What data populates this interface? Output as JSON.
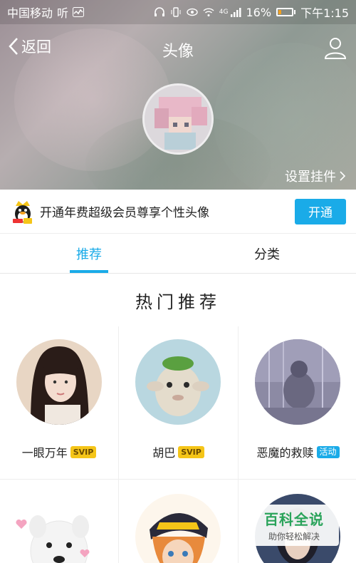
{
  "status_bar": {
    "carrier": "中国移动",
    "speaker_hint": "听",
    "signal_label": "4G",
    "battery": "16%",
    "time": "下午1:15"
  },
  "nav": {
    "back_label": "返回",
    "title": "头像"
  },
  "hero": {
    "pendant_label": "设置挂件"
  },
  "vip_banner": {
    "text": "开通年费超级会员尊享个性头像",
    "button_label": "开通"
  },
  "tabs": [
    {
      "label": "推荐",
      "active": true
    },
    {
      "label": "分类",
      "active": false
    }
  ],
  "section_title": "热门推荐",
  "grid": {
    "items": [
      {
        "name": "一眼万年",
        "badge": "SVIP",
        "badge_type": "svip"
      },
      {
        "name": "胡巴",
        "badge": "SVIP",
        "badge_type": "svip"
      },
      {
        "name": "恶魔的救赎",
        "badge": "活动",
        "badge_type": "event"
      }
    ]
  },
  "watermark": {
    "title": "百科全说",
    "subtitle": "助你轻松解决"
  },
  "colors": {
    "accent": "#1aabe8",
    "svip_badge": "#f5c518"
  }
}
